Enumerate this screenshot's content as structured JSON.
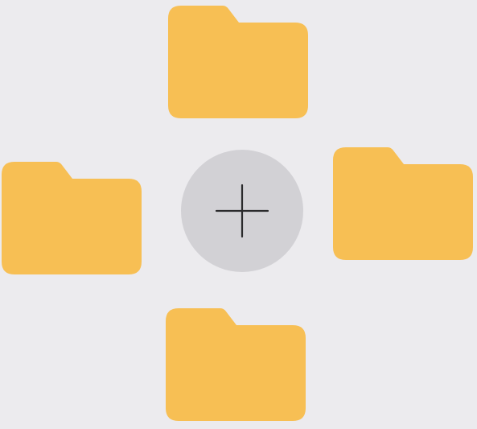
{
  "colors": {
    "background": "#ecebee",
    "folder": "#f7bf54",
    "add_button_fill": "#d2d1d5",
    "add_button_glyph": "#2a2a2c"
  },
  "folders": [
    {
      "id": "folder-top",
      "icon": "folder-icon"
    },
    {
      "id": "folder-left",
      "icon": "folder-icon"
    },
    {
      "id": "folder-right",
      "icon": "folder-icon"
    },
    {
      "id": "folder-bottom",
      "icon": "folder-icon"
    }
  ],
  "add_button": {
    "icon": "plus-icon"
  }
}
